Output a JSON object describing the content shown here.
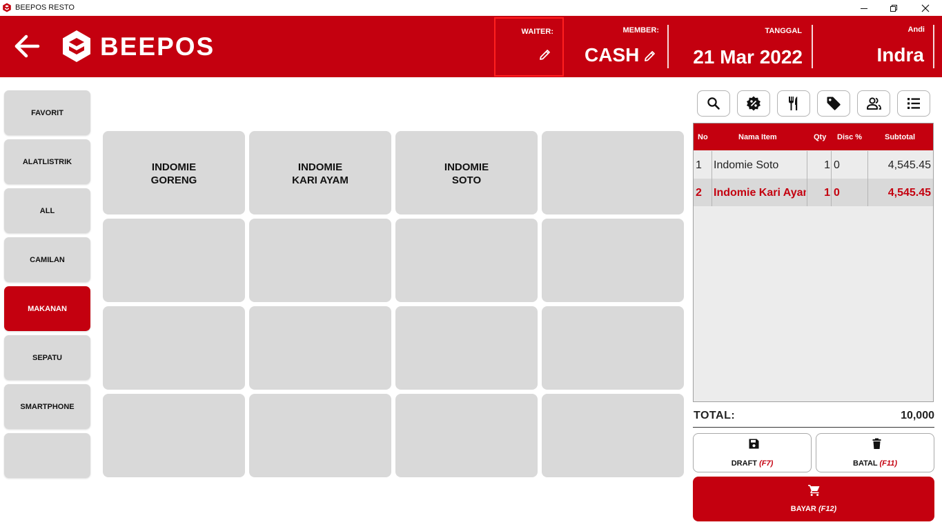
{
  "window": {
    "title": "BEEPOS RESTO"
  },
  "header": {
    "brand": "BEEPOS",
    "waiter_label": "WAITER:",
    "member_label": "MEMBER:",
    "member_value": "CASH",
    "date_label": "TANGGAL",
    "date_value": "21 Mar 2022",
    "user_label": "Andi",
    "user_value": "Indra"
  },
  "categories": [
    {
      "label": "FAVORIT",
      "active": false
    },
    {
      "label": "ALATLISTRIK",
      "active": false
    },
    {
      "label": "ALL",
      "active": false
    },
    {
      "label": "CAMILAN",
      "active": false
    },
    {
      "label": "MAKANAN",
      "active": true
    },
    {
      "label": "SEPATU",
      "active": false
    },
    {
      "label": "SMARTPHONE",
      "active": false
    },
    {
      "label": "",
      "active": false
    }
  ],
  "products": [
    {
      "name": "INDOMIE\nGORENG"
    },
    {
      "name": "INDOMIE\nKARI AYAM"
    },
    {
      "name": "INDOMIE\nSOTO"
    }
  ],
  "tools": [
    "search-icon",
    "discount-icon",
    "restaurant-icon",
    "tag-icon",
    "customer-icon",
    "list-icon"
  ],
  "order": {
    "columns": {
      "no": "No",
      "item": "Nama Item",
      "qty": "Qty",
      "disc": "Disc %",
      "subtotal": "Subtotal"
    },
    "rows": [
      {
        "no": "1",
        "item": "Indomie Soto",
        "qty": "1",
        "disc": "0",
        "subtotal": "4,545.45",
        "selected": false
      },
      {
        "no": "2",
        "item": "Indomie Kari Ayam",
        "qty": "1",
        "disc": "0",
        "subtotal": "4,545.45",
        "selected": true
      }
    ],
    "total_label": "TOTAL:",
    "total_value": "10,000"
  },
  "actions": {
    "draft_label": "DRAFT",
    "draft_key": "(F7)",
    "cancel_label": "BATAL",
    "cancel_key": "(F11)",
    "pay_label": "BAYAR",
    "pay_key": "(F12)"
  },
  "colors": {
    "brand_red": "#c4000f",
    "tile_gray": "#d9d9d9",
    "panel_gray": "#ececec"
  }
}
